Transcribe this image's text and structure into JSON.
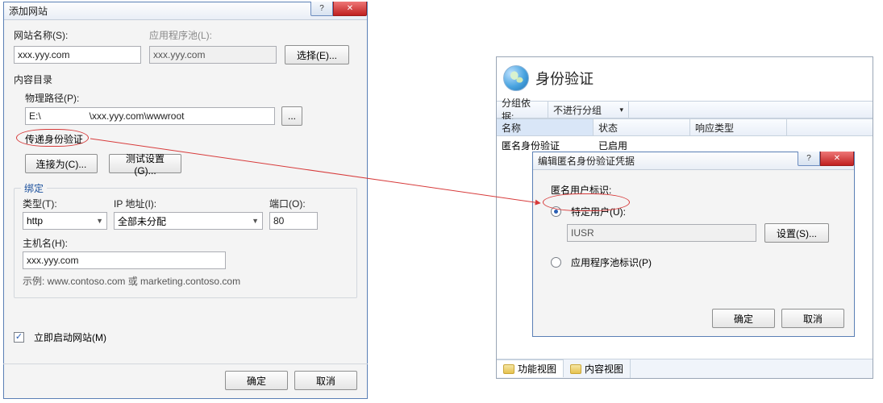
{
  "add_site_dialog": {
    "title": "添加网站",
    "site_name_label": "网站名称(S):",
    "site_name_value": "xxx.yyy.com",
    "app_pool_label": "应用程序池(L):",
    "app_pool_value": "xxx.yyy.com",
    "select_pool_btn": "选择(E)...",
    "content_group": "内容目录",
    "phys_path_label": "物理路径(P):",
    "phys_path_left": "E:\\",
    "phys_path_right": "\\xxx.yyy.com\\wwwroot",
    "browse_btn": "...",
    "passthrough_label": "传递身份验证",
    "connect_as_btn": "连接为(C)...",
    "test_settings_btn": "测试设置(G)...",
    "binding_group": "绑定",
    "type_label": "类型(T):",
    "type_value": "http",
    "ip_label": "IP 地址(I):",
    "ip_value": "全部未分配",
    "port_label": "端口(O):",
    "port_value": "80",
    "host_label": "主机名(H):",
    "host_value": "xxx.yyy.com",
    "host_example": "示例: www.contoso.com 或 marketing.contoso.com",
    "start_now_label": "立即启动网站(M)",
    "ok_btn": "确定",
    "cancel_btn": "取消"
  },
  "iis_pane": {
    "title": "身份验证",
    "group_by_label": "分组依据:",
    "group_by_value": "不进行分组",
    "col_name": "名称",
    "col_status": "状态",
    "col_resp": "响应类型",
    "row_name": "匿名身份验证",
    "row_status": "已启用",
    "tab_feature": "功能视图",
    "tab_content": "内容视图"
  },
  "edit_anon_dialog": {
    "title": "编辑匿名身份验证凭据",
    "identity_label": "匿名用户标识:",
    "radio_user": "特定用户(U):",
    "user_value": "IUSR",
    "set_btn": "设置(S)...",
    "radio_pool": "应用程序池标识(P)",
    "ok_btn": "确定",
    "cancel_btn": "取消"
  }
}
